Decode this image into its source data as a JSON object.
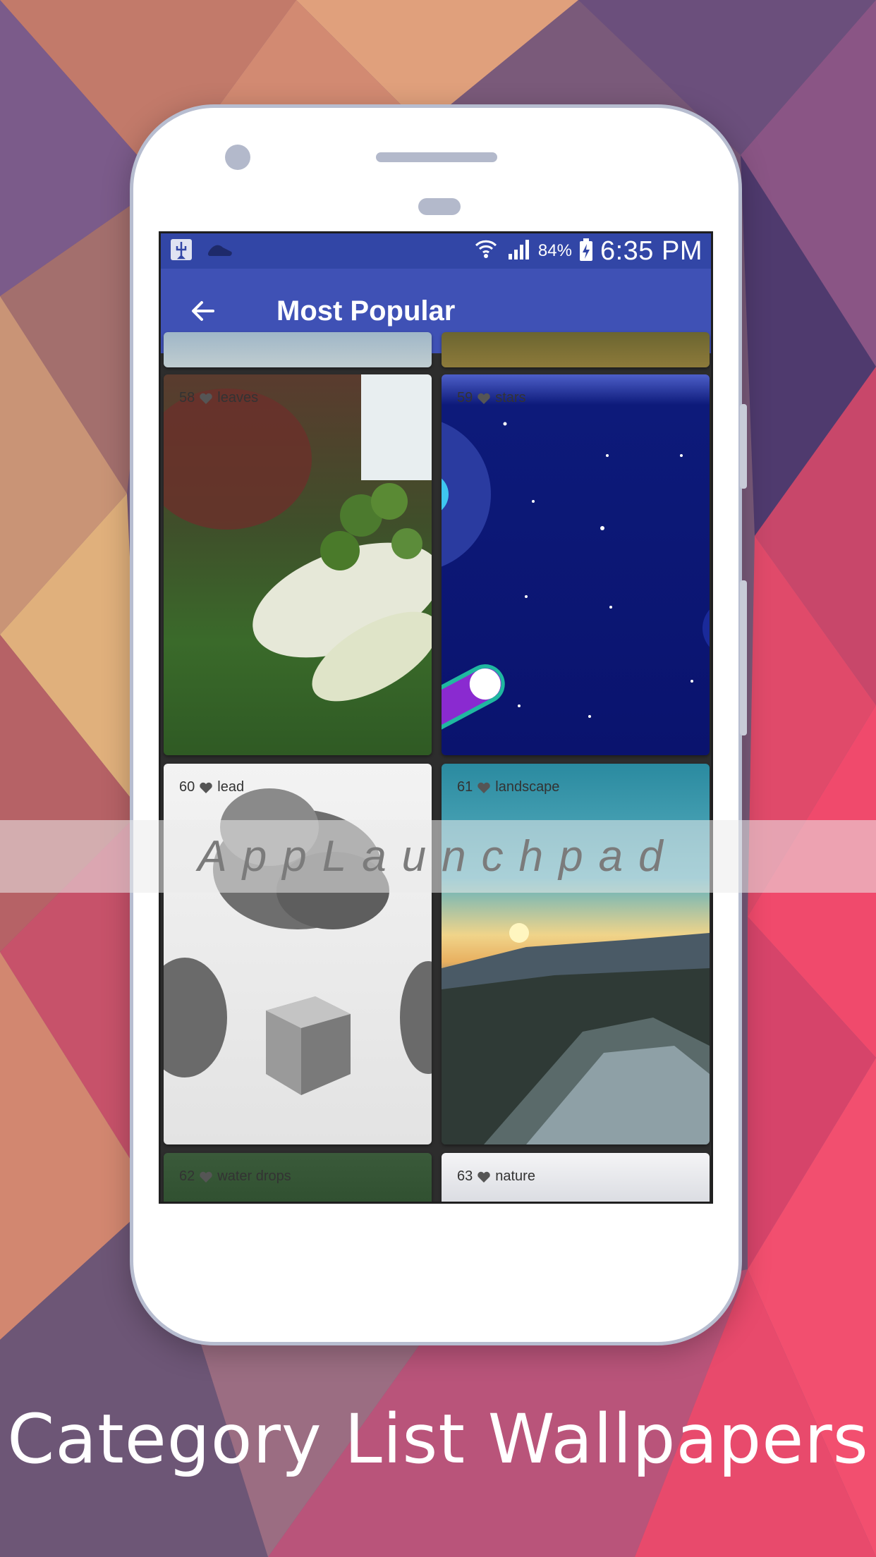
{
  "statusbar": {
    "battery": "84%",
    "time": "6:35 PM",
    "icons": [
      "usb-icon",
      "footprint-icon",
      "wifi-icon",
      "signal-icon",
      "battery-charging-icon"
    ]
  },
  "appbar": {
    "title": "Most Popular",
    "back_icon": "arrow-back-icon"
  },
  "tiles": [
    {
      "num": "58",
      "name": "leaves"
    },
    {
      "num": "59",
      "name": "stars"
    },
    {
      "num": "60",
      "name": "lead"
    },
    {
      "num": "61",
      "name": "landscape"
    },
    {
      "num": "62",
      "name": "water drops"
    },
    {
      "num": "63",
      "name": "nature"
    }
  ],
  "watermark": "AppLaunchpad",
  "caption": "Category List Wallpapers",
  "colors": {
    "statusbar": "#3246a6",
    "appbar": "#3f51b5",
    "phone_frame": "#b7bdd0"
  }
}
